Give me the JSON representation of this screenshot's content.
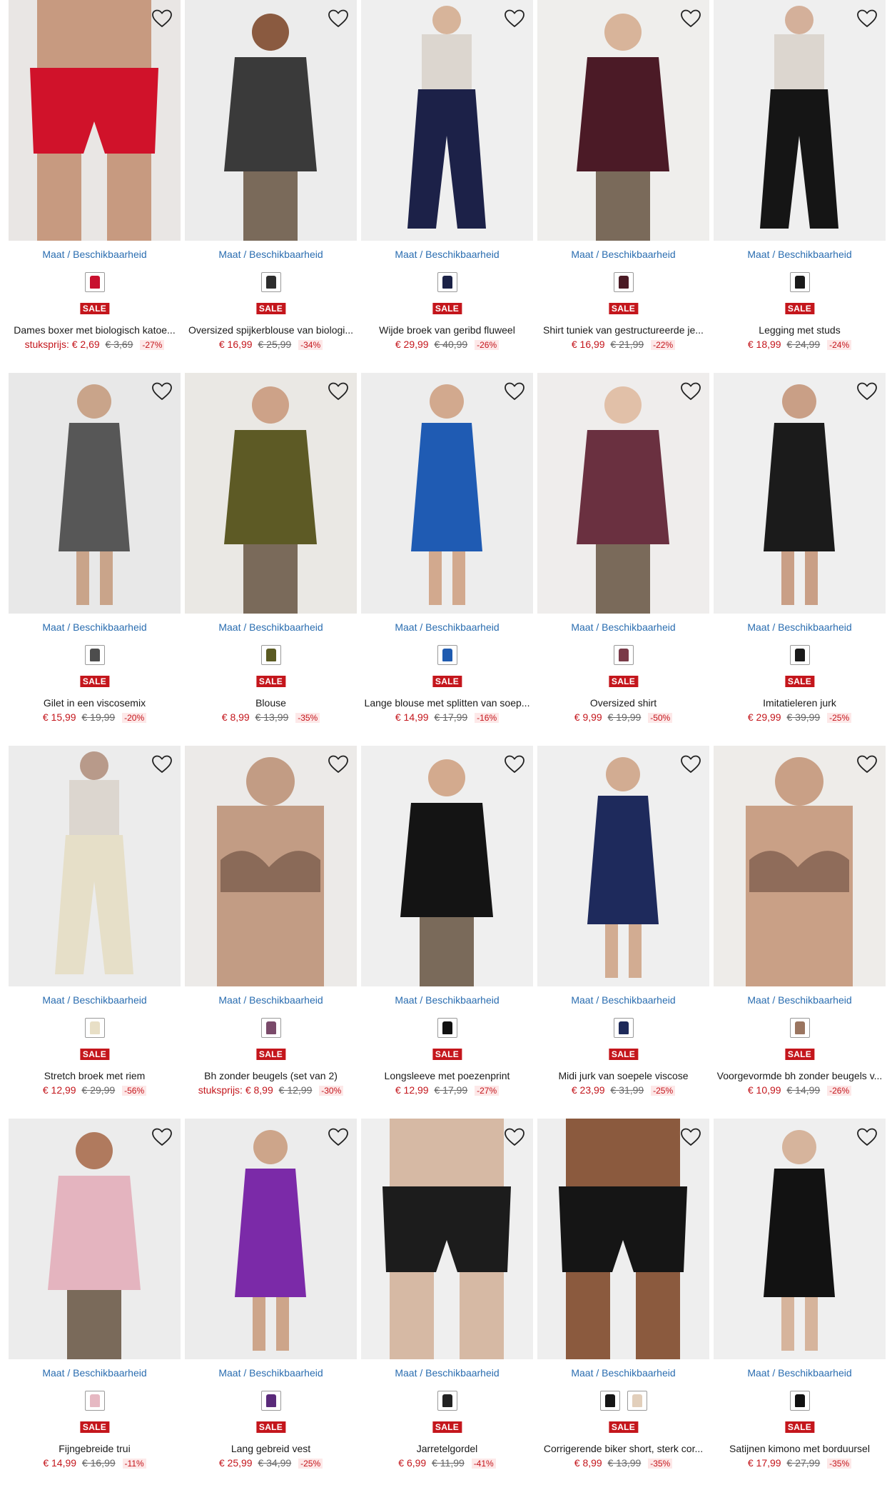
{
  "size_link_label": "Maat / Beschikbaarheid",
  "sale_label": "SALE",
  "colors": {
    "sale": "#c4161c",
    "link": "#2a6db0"
  },
  "products": [
    {
      "title": "Dames boxer met biologisch katoe...",
      "prefix": "stuksprijs:",
      "price": "€ 2,69",
      "old": "€ 3,69",
      "discount": "-27%",
      "swatches": [
        "#c8102e"
      ],
      "img": {
        "bg": "#e9e6e4",
        "main": "#d0122a",
        "skin": "#c79a80",
        "kind": "boxer"
      }
    },
    {
      "title": "Oversized spijkerblouse van biologi...",
      "prefix": "",
      "price": "€ 16,99",
      "old": "€ 25,99",
      "discount": "-34%",
      "swatches": [
        "#2d2d2d"
      ],
      "img": {
        "bg": "#ececec",
        "main": "#3a3a3a",
        "skin": "#8a5a40",
        "kind": "top"
      }
    },
    {
      "title": "Wijde broek van geribd fluweel",
      "prefix": "",
      "price": "€ 29,99",
      "old": "€ 40,99",
      "discount": "-26%",
      "swatches": [
        "#1b2247"
      ],
      "img": {
        "bg": "#efefef",
        "main": "#1c2148",
        "skin": "#d7b49a",
        "kind": "pants"
      }
    },
    {
      "title": "Shirt tuniek van gestructureerde je...",
      "prefix": "",
      "price": "€ 16,99",
      "old": "€ 21,99",
      "discount": "-22%",
      "swatches": [
        "#4a1a24"
      ],
      "img": {
        "bg": "#efeeec",
        "main": "#4b1a26",
        "skin": "#d8b49a",
        "kind": "top"
      }
    },
    {
      "title": "Legging met studs",
      "prefix": "",
      "price": "€ 18,99",
      "old": "€ 24,99",
      "discount": "-24%",
      "swatches": [
        "#1a1a1a"
      ],
      "img": {
        "bg": "#efefef",
        "main": "#151515",
        "skin": "#d4b09a",
        "kind": "pants"
      }
    },
    {
      "title": "Gilet in een viscosemix",
      "prefix": "",
      "price": "€ 15,99",
      "old": "€ 19,99",
      "discount": "-20%",
      "swatches": [
        "#4d4d4d"
      ],
      "img": {
        "bg": "#e8e8e8",
        "main": "#575757",
        "skin": "#c9a48a",
        "kind": "dress"
      }
    },
    {
      "title": "Blouse",
      "prefix": "",
      "price": "€ 8,99",
      "old": "€ 13,99",
      "discount": "-35%",
      "swatches": [
        "#5a5a22"
      ],
      "img": {
        "bg": "#eae8e4",
        "main": "#5d5a25",
        "skin": "#cda288",
        "kind": "top"
      }
    },
    {
      "title": "Lange blouse met splitten van soep...",
      "prefix": "",
      "price": "€ 14,99",
      "old": "€ 17,99",
      "discount": "-16%",
      "swatches": [
        "#1f5bb0"
      ],
      "img": {
        "bg": "#ededed",
        "main": "#1f5bb3",
        "skin": "#d2a98e",
        "kind": "dress"
      }
    },
    {
      "title": "Oversized shirt",
      "prefix": "",
      "price": "€ 9,99",
      "old": "€ 19,99",
      "discount": "-50%",
      "swatches": [
        "#7a3a48"
      ],
      "img": {
        "bg": "#efedec",
        "main": "#6a3040",
        "skin": "#e1c0a8",
        "kind": "top"
      }
    },
    {
      "title": "Imitatieleren jurk",
      "prefix": "",
      "price": "€ 29,99",
      "old": "€ 39,99",
      "discount": "-25%",
      "swatches": [
        "#1a1a1a"
      ],
      "img": {
        "bg": "#efefef",
        "main": "#1b1b1b",
        "skin": "#c99f86",
        "kind": "dress"
      }
    },
    {
      "title": "Stretch broek met riem",
      "prefix": "",
      "price": "€ 12,99",
      "old": "€ 29,99",
      "discount": "-56%",
      "swatches": [
        "#e8dfc6"
      ],
      "img": {
        "bg": "#ececec",
        "main": "#e6dfc8",
        "skin": "#b89a8a",
        "kind": "pants"
      }
    },
    {
      "title": "Bh zonder beugels (set van 2)",
      "prefix": "stuksprijs:",
      "price": "€ 8,99",
      "old": "€ 12,99",
      "discount": "-30%",
      "swatches": [
        "#7a4a6a"
      ],
      "img": {
        "bg": "#eceae8",
        "main": "#8a6a58",
        "skin": "#c29c84",
        "kind": "bra"
      }
    },
    {
      "title": "Longsleeve met poezenprint",
      "prefix": "",
      "price": "€ 12,99",
      "old": "€ 17,99",
      "discount": "-27%",
      "swatches": [
        "#111111"
      ],
      "img": {
        "bg": "#efefef",
        "main": "#141414",
        "skin": "#d3aa8e",
        "kind": "top"
      }
    },
    {
      "title": "Midi jurk van soepele viscose",
      "prefix": "",
      "price": "€ 23,99",
      "old": "€ 31,99",
      "discount": "-25%",
      "swatches": [
        "#1e2a5a"
      ],
      "img": {
        "bg": "#efefef",
        "main": "#1e2a5c",
        "skin": "#d2ac92",
        "kind": "dress"
      }
    },
    {
      "title": "Voorgevormde bh zonder beugels v...",
      "prefix": "",
      "price": "€ 10,99",
      "old": "€ 14,99",
      "discount": "-26%",
      "swatches": [
        "#9a7560"
      ],
      "img": {
        "bg": "#eeece9",
        "main": "#8f6c5a",
        "skin": "#c9a086",
        "kind": "bra"
      }
    },
    {
      "title": "Fijngebreide trui",
      "prefix": "",
      "price": "€ 14,99",
      "old": "€ 16,99",
      "discount": "-11%",
      "swatches": [
        "#e6b8c2"
      ],
      "img": {
        "bg": "#ececec",
        "main": "#e4b4bf",
        "skin": "#b07a5e",
        "kind": "top"
      }
    },
    {
      "title": "Lang gebreid vest",
      "prefix": "",
      "price": "€ 25,99",
      "old": "€ 34,99",
      "discount": "-25%",
      "swatches": [
        "#5a2a7a"
      ],
      "img": {
        "bg": "#ececec",
        "main": "#7b2aa8",
        "skin": "#cda58a",
        "kind": "dress"
      }
    },
    {
      "title": "Jarretelgordel",
      "prefix": "",
      "price": "€ 6,99",
      "old": "€ 11,99",
      "discount": "-41%",
      "swatches": [
        "#222222"
      ],
      "img": {
        "bg": "#efefef",
        "main": "#1c1c1c",
        "skin": "#d6b9a4",
        "kind": "boxer"
      }
    },
    {
      "title": "Corrigerende biker short, sterk cor...",
      "prefix": "",
      "price": "€ 8,99",
      "old": "€ 13,99",
      "discount": "-35%",
      "swatches": [
        "#151515",
        "#e2cfbb"
      ],
      "img": {
        "bg": "#eeeeee",
        "main": "#151515",
        "skin": "#8b5a3e",
        "kind": "boxer"
      }
    },
    {
      "title": "Satijnen kimono met borduursel",
      "prefix": "",
      "price": "€ 17,99",
      "old": "€ 27,99",
      "discount": "-35%",
      "swatches": [
        "#111111"
      ],
      "img": {
        "bg": "#efefef",
        "main": "#121212",
        "skin": "#d6b49c",
        "kind": "dress"
      }
    }
  ]
}
